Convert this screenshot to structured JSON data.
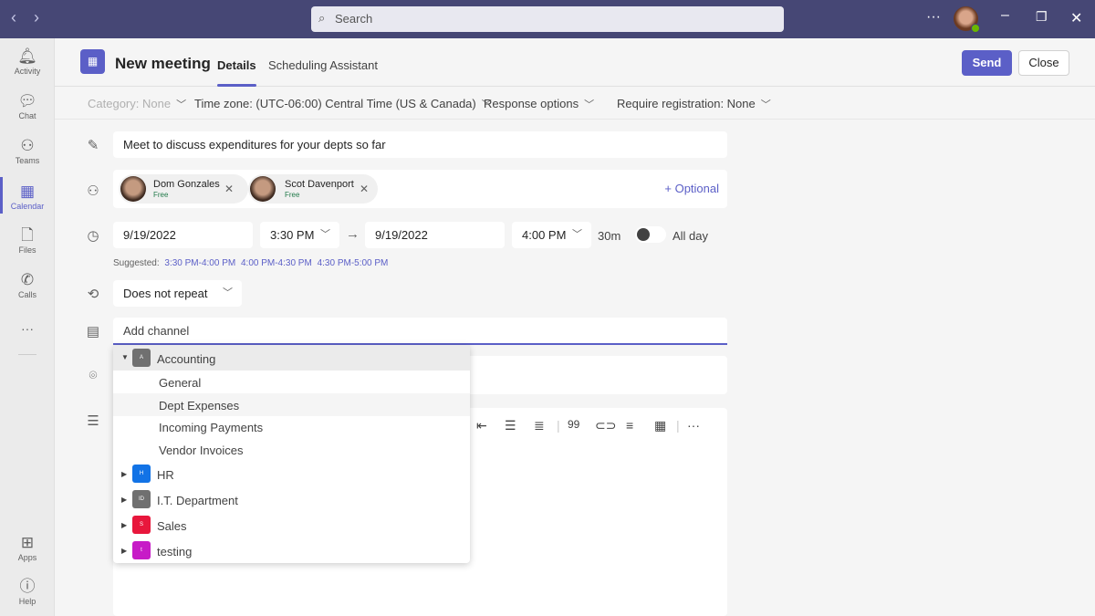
{
  "topbar": {
    "search_placeholder": "Search",
    "more": "···"
  },
  "sidebar": {
    "items": [
      {
        "label": "Activity",
        "icon": "bell-icon"
      },
      {
        "label": "Chat",
        "icon": "chat-icon"
      },
      {
        "label": "Teams",
        "icon": "teams-icon"
      },
      {
        "label": "Calendar",
        "icon": "calendar-icon",
        "active": true
      },
      {
        "label": "Files",
        "icon": "file-icon"
      },
      {
        "label": "Calls",
        "icon": "phone-icon"
      }
    ],
    "more": "···",
    "apps": "Apps",
    "help": "Help"
  },
  "header": {
    "title": "New meeting",
    "tabs": [
      "Details",
      "Scheduling Assistant"
    ],
    "send": "Send",
    "close": "Close"
  },
  "options": {
    "category": "Category: None",
    "timezone": "Time zone: (UTC-06:00) Central Time (US & Canada)",
    "response": "Response options",
    "registration": "Require registration: None"
  },
  "form": {
    "title_value": "Meet to discuss expenditures for your depts so far",
    "attendees": [
      {
        "name": "Dom Gonzales",
        "status": "Free"
      },
      {
        "name": "Scot Davenport",
        "status": "Free"
      }
    ],
    "optional": "+ Optional",
    "start_date": "9/19/2022",
    "start_time": "3:30 PM",
    "end_date": "9/19/2022",
    "end_time": "4:00 PM",
    "duration": "30m",
    "all_day": "All day",
    "all_day_on": false,
    "suggested_label": "Suggested:",
    "suggested": [
      "3:30 PM-4:00 PM",
      "4:00 PM-4:30 PM",
      "4:30 PM-5:00 PM"
    ],
    "repeat": "Does not repeat",
    "channel_placeholder": "Add channel"
  },
  "channel_dropdown": {
    "teams": [
      {
        "name": "Accounting",
        "initial": "A",
        "color": "#707070",
        "expanded": true,
        "channels": [
          "General",
          "Dept Expenses",
          "Incoming Payments",
          "Vendor Invoices"
        ],
        "hovered_channel": "Dept Expenses"
      },
      {
        "name": "HR",
        "initial": "H",
        "color": "#1273e6"
      },
      {
        "name": "I.T. Department",
        "initial": "ID",
        "color": "#707070"
      },
      {
        "name": "Sales",
        "initial": "S",
        "color": "#e8173c"
      },
      {
        "name": "testing",
        "initial": "t",
        "color": "#c71bc7"
      }
    ]
  },
  "colors": {
    "brand": "#5b5fc7",
    "topbar": "#464775",
    "free": "#237b4b"
  }
}
